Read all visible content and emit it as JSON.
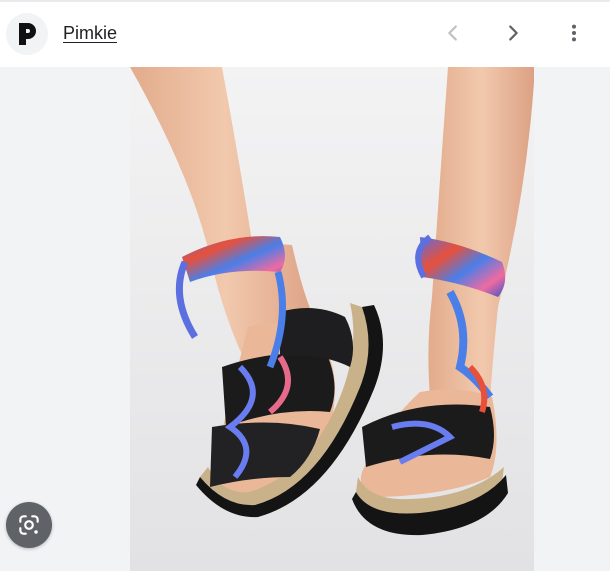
{
  "header": {
    "site_name": "Pimkie",
    "logo_icon": "pimkie-p-logo",
    "prev_icon": "chevron-left-icon",
    "next_icon": "chevron-right-icon",
    "more_icon": "more-vert-icon"
  },
  "image": {
    "subject": "photo",
    "lens_icon": "google-lens-icon"
  },
  "colors": {
    "background": "#f1f3f4",
    "header_bg": "#ffffff",
    "text": "#202124",
    "icon_dim": "#bdc1c6",
    "icon": "#5f6368",
    "lens_bg": "#5f6368"
  }
}
